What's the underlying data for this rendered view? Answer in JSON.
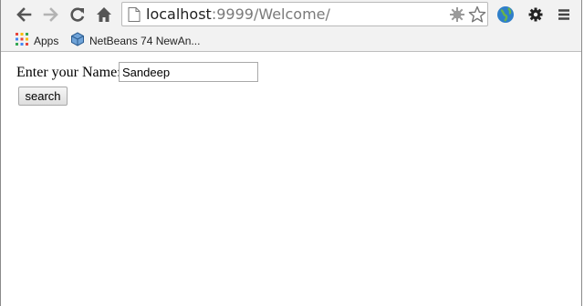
{
  "browser": {
    "address_bar": {
      "host": "localhost",
      "path": ":9999/Welcome/"
    },
    "icons": [
      "back-arrow-icon",
      "forward-arrow-icon",
      "reload-icon",
      "home-icon",
      "page-icon",
      "extension-icon",
      "star-icon",
      "globe-icon",
      "settings-gear-icon",
      "menu-icon"
    ]
  },
  "bookmarks": {
    "items": [
      {
        "label": "Apps",
        "icon": "apps-grid-icon"
      },
      {
        "label": "NetBeans 74 NewAn...",
        "icon": "netbeans-cube-icon"
      }
    ]
  },
  "form": {
    "name_label": "Enter your Name:",
    "name_value": "Sandeep",
    "search_label": "search"
  }
}
